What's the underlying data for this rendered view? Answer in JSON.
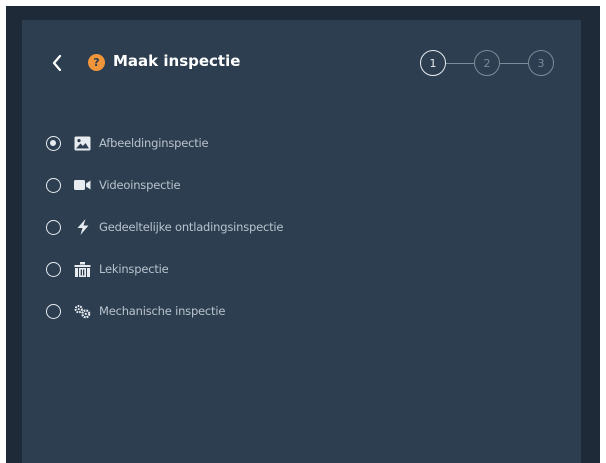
{
  "header": {
    "title": "Maak inspectie",
    "help_symbol": "?",
    "back_icon": "chevron-left-icon",
    "help_icon": "help-circle-icon"
  },
  "stepper": {
    "steps": [
      "1",
      "2",
      "3"
    ],
    "current_step": 1
  },
  "options": [
    {
      "label": "Afbeeldinginspectie",
      "icon": "image-icon",
      "selected": true
    },
    {
      "label": "Videoinspectie",
      "icon": "video-camera-icon",
      "selected": false
    },
    {
      "label": "Gedeeltelijke ontladingsinspectie",
      "icon": "lightning-bolt-icon",
      "selected": false
    },
    {
      "label": "Lekinspectie",
      "icon": "leak-icon",
      "selected": false
    },
    {
      "label": "Mechanische inspectie",
      "icon": "gears-icon",
      "selected": false
    }
  ],
  "colors": {
    "panel": "#2c3e50",
    "backdrop": "#1e2a38",
    "accent": "#f0953a",
    "text": "#ffffff",
    "option_text": "#b9c3cd",
    "step_active": "#e8ecf0",
    "step_inactive": "#7d8a97"
  }
}
